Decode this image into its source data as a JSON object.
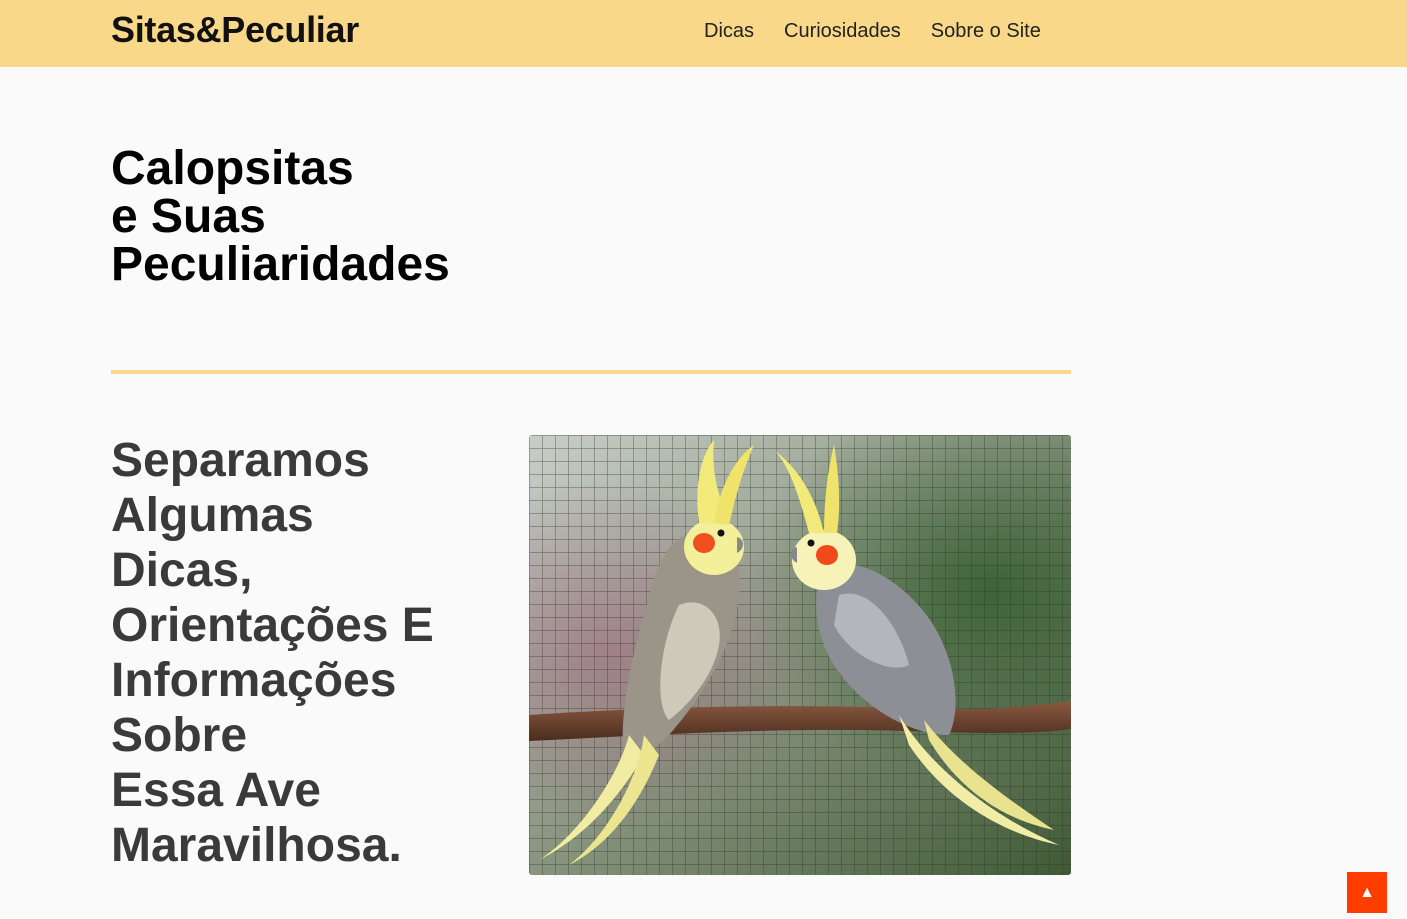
{
  "header": {
    "logo": "Sitas&Peculiar",
    "nav": [
      "Dicas",
      "Curiosidades",
      "Sobre o Site"
    ]
  },
  "hero": {
    "title_lines": [
      "Calopsitas",
      "e Suas",
      "Peculiaridades"
    ]
  },
  "intro": {
    "text_lines": [
      "Separamos",
      "Algumas",
      "Dicas,",
      "Orientações E",
      "Informações",
      "Sobre",
      "Essa Ave",
      "Maravilhosa."
    ]
  },
  "image": {
    "subject": "two cockatiels perched on a branch in front of a wire mesh"
  },
  "back_to_top": {
    "icon": "arrow-up-icon",
    "glyph": "▲"
  },
  "colors": {
    "header_bg": "#fad889",
    "page_bg": "#fafafa",
    "divider": "#fad889",
    "back_to_top_bg": "#ff3d00",
    "text_dark": "#000000",
    "text_gray": "#3a3a3a"
  }
}
